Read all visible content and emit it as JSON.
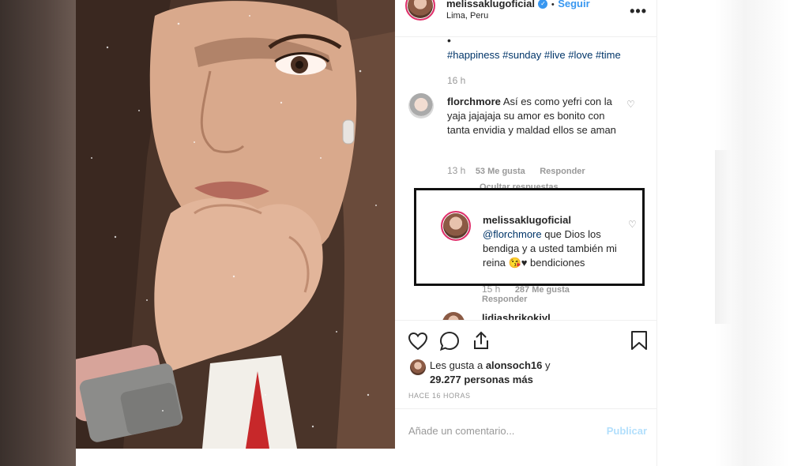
{
  "post": {
    "username": "melissaklugoficial",
    "verified_mark": "✓",
    "separator": "•",
    "follow_label": "Seguir",
    "location": "Lima, Peru",
    "more_icon": "•••"
  },
  "caption": {
    "dot": "•",
    "hashtags": "#happiness #sunday #live #love #time",
    "time": "16 h"
  },
  "comments": [
    {
      "username": "florchmore",
      "text": "Así es como yefri con la yaja jajajaja su amor es bonito con tanta envidia y maldad ellos se aman",
      "time": "13 h",
      "likes": "53 Me gusta",
      "reply_label": "Responder",
      "hide_replies": "Ocultar respuestas"
    }
  ],
  "reply": {
    "username": "melissaklugoficial",
    "mention": "@florchmore",
    "text": " que Dios los bendiga y a usted también mi reina 😘♥ bendiciones",
    "time": "15 h",
    "likes": "287 Me gusta",
    "reply_label": "Responder"
  },
  "next_comment_user": "lidiashrikokiyl",
  "likes": {
    "prefix": "Les gusta a ",
    "user": "alonsoch16",
    "suffix": " y",
    "others": "29.277 personas más"
  },
  "time_ago": "HACE 16 HORAS",
  "add_comment": {
    "placeholder": "Añade un comentario...",
    "publish_label": "Publicar"
  },
  "colors": {
    "link_blue": "#3897f0",
    "hashtag": "#003569",
    "publish_disabled": "#b2dffc",
    "highlight_border": "#111111"
  }
}
